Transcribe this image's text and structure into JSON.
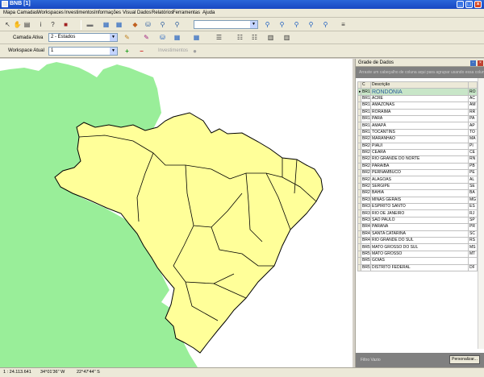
{
  "window": {
    "title": "BNB [1]"
  },
  "menu": [
    "Mapa",
    "Camadas",
    "Workspaces",
    "Investimentos",
    "Informações",
    "Visual",
    "Dados",
    "Relatórios",
    "Ferramentas",
    "Ajuda"
  ],
  "toolbar2": {
    "camada_label": "Camada Ativa",
    "camada_value": "2 - Estados"
  },
  "toolbar3": {
    "workspace_label": "Workspace Atual",
    "workspace_value": "1",
    "investimentos_label": "Investimentos"
  },
  "grid": {
    "title": "Grade de Dados",
    "group_hint": "Arraste um cabeçalho de coluna aqui para agrupar usando essa coluna",
    "headers": [
      "C",
      "Descrição"
    ],
    "rows": [
      [
        "BR1",
        "RONDÔNIA",
        "RO"
      ],
      [
        "BR1",
        "ACRE",
        "AC"
      ],
      [
        "BR1",
        "AMAZONAS",
        "AM"
      ],
      [
        "BR1",
        "RORAIMA",
        "RR"
      ],
      [
        "BR1",
        "PARÁ",
        "PA"
      ],
      [
        "BR1",
        "AMAPÁ",
        "AP"
      ],
      [
        "BR1",
        "TOCANTINS",
        "TO"
      ],
      [
        "BR2",
        "MARANHÃO",
        "MA"
      ],
      [
        "BR2",
        "PIAUÍ",
        "PI"
      ],
      [
        "BR2",
        "CEARÁ",
        "CE"
      ],
      [
        "BR2",
        "RIO GRANDE DO NORTE",
        "RN"
      ],
      [
        "BR2",
        "PARAÍBA",
        "PB"
      ],
      [
        "BR2",
        "PERNAMBUCO",
        "PE"
      ],
      [
        "BR2",
        "ALAGOAS",
        "AL"
      ],
      [
        "BR2",
        "SERGIPE",
        "SE"
      ],
      [
        "BR2",
        "BAHIA",
        "BA"
      ],
      [
        "BR3",
        "MINAS GERAIS",
        "MG"
      ],
      [
        "BR3",
        "ESPÍRITO SANTO",
        "ES"
      ],
      [
        "BR3",
        "RIO DE JANEIRO",
        "RJ"
      ],
      [
        "BR3",
        "SÃO PAULO",
        "SP"
      ],
      [
        "BR4",
        "PARANÁ",
        "PR"
      ],
      [
        "BR4",
        "SANTA CATARINA",
        "SC"
      ],
      [
        "BR4",
        "RIO GRANDE DO SUL",
        "RS"
      ],
      [
        "BR5",
        "MATO GROSSO DO SUL",
        "MS"
      ],
      [
        "BR5",
        "MATO GROSSO",
        "MT"
      ],
      [
        "BR5",
        "GOIÁS",
        ""
      ],
      [
        "BR5",
        "DISTRITO FEDERAL",
        "DF"
      ]
    ],
    "filter_label": "Filtro Vazio",
    "customize_label": "Personalizar..."
  },
  "status": {
    "scale": "1 : 24.113.641",
    "lon": "34°01'36\" W",
    "lat": "22°47'44\" S"
  },
  "colors": {
    "states": "#ffff99",
    "neighbors": "#99ee99",
    "selected_row": "#c8e6c8",
    "titlebar": "#1f58cf"
  }
}
